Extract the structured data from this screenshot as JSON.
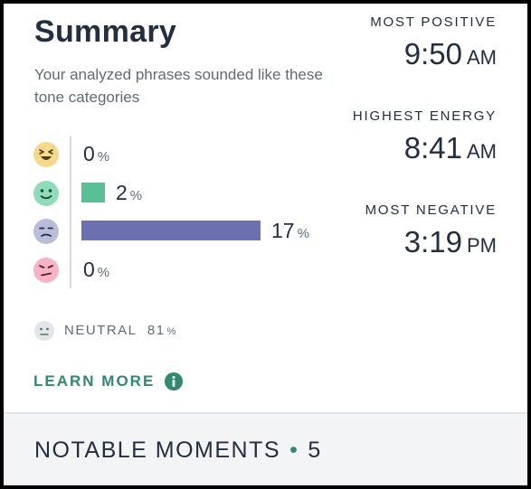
{
  "summary": {
    "title": "Summary",
    "subtitle": "Your analyzed phrases sounded like these tone categories"
  },
  "tones": [
    {
      "name": "positive-high",
      "value": "0",
      "percent": 0,
      "unit": "%",
      "face_color": "#f5d98b",
      "bar_color": "#f5d98b",
      "icon": "laughing-face-icon"
    },
    {
      "name": "positive",
      "value": "2",
      "percent": 2,
      "unit": "%",
      "face_color": "#8fdcb8",
      "bar_color": "#58bf95",
      "icon": "smiling-face-icon"
    },
    {
      "name": "negative-low",
      "value": "17",
      "percent": 17,
      "unit": "%",
      "face_color": "#b9bdd9",
      "bar_color": "#6c70b0",
      "icon": "sad-face-icon"
    },
    {
      "name": "negative",
      "value": "0",
      "percent": 0,
      "unit": "%",
      "face_color": "#f5b3c3",
      "bar_color": "#f5b3c3",
      "icon": "annoyed-face-icon"
    }
  ],
  "neutral": {
    "label": "NEUTRAL",
    "value": "81",
    "unit": "%",
    "icon": "neutral-face-icon"
  },
  "learn_more": {
    "label": "LEARN MORE",
    "icon": "info-icon"
  },
  "moments": [
    {
      "label": "MOST POSITIVE",
      "time": "9:50",
      "ampm": "AM"
    },
    {
      "label": "HIGHEST ENERGY",
      "time": "8:41",
      "ampm": "AM"
    },
    {
      "label": "MOST NEGATIVE",
      "time": "3:19",
      "ampm": "PM"
    }
  ],
  "notable": {
    "label": "NOTABLE MOMENTS",
    "separator": "•",
    "count": "5"
  },
  "colors": {
    "accent": "#2d8a6f",
    "text": "#232f3e",
    "muted": "#5f6b75"
  }
}
